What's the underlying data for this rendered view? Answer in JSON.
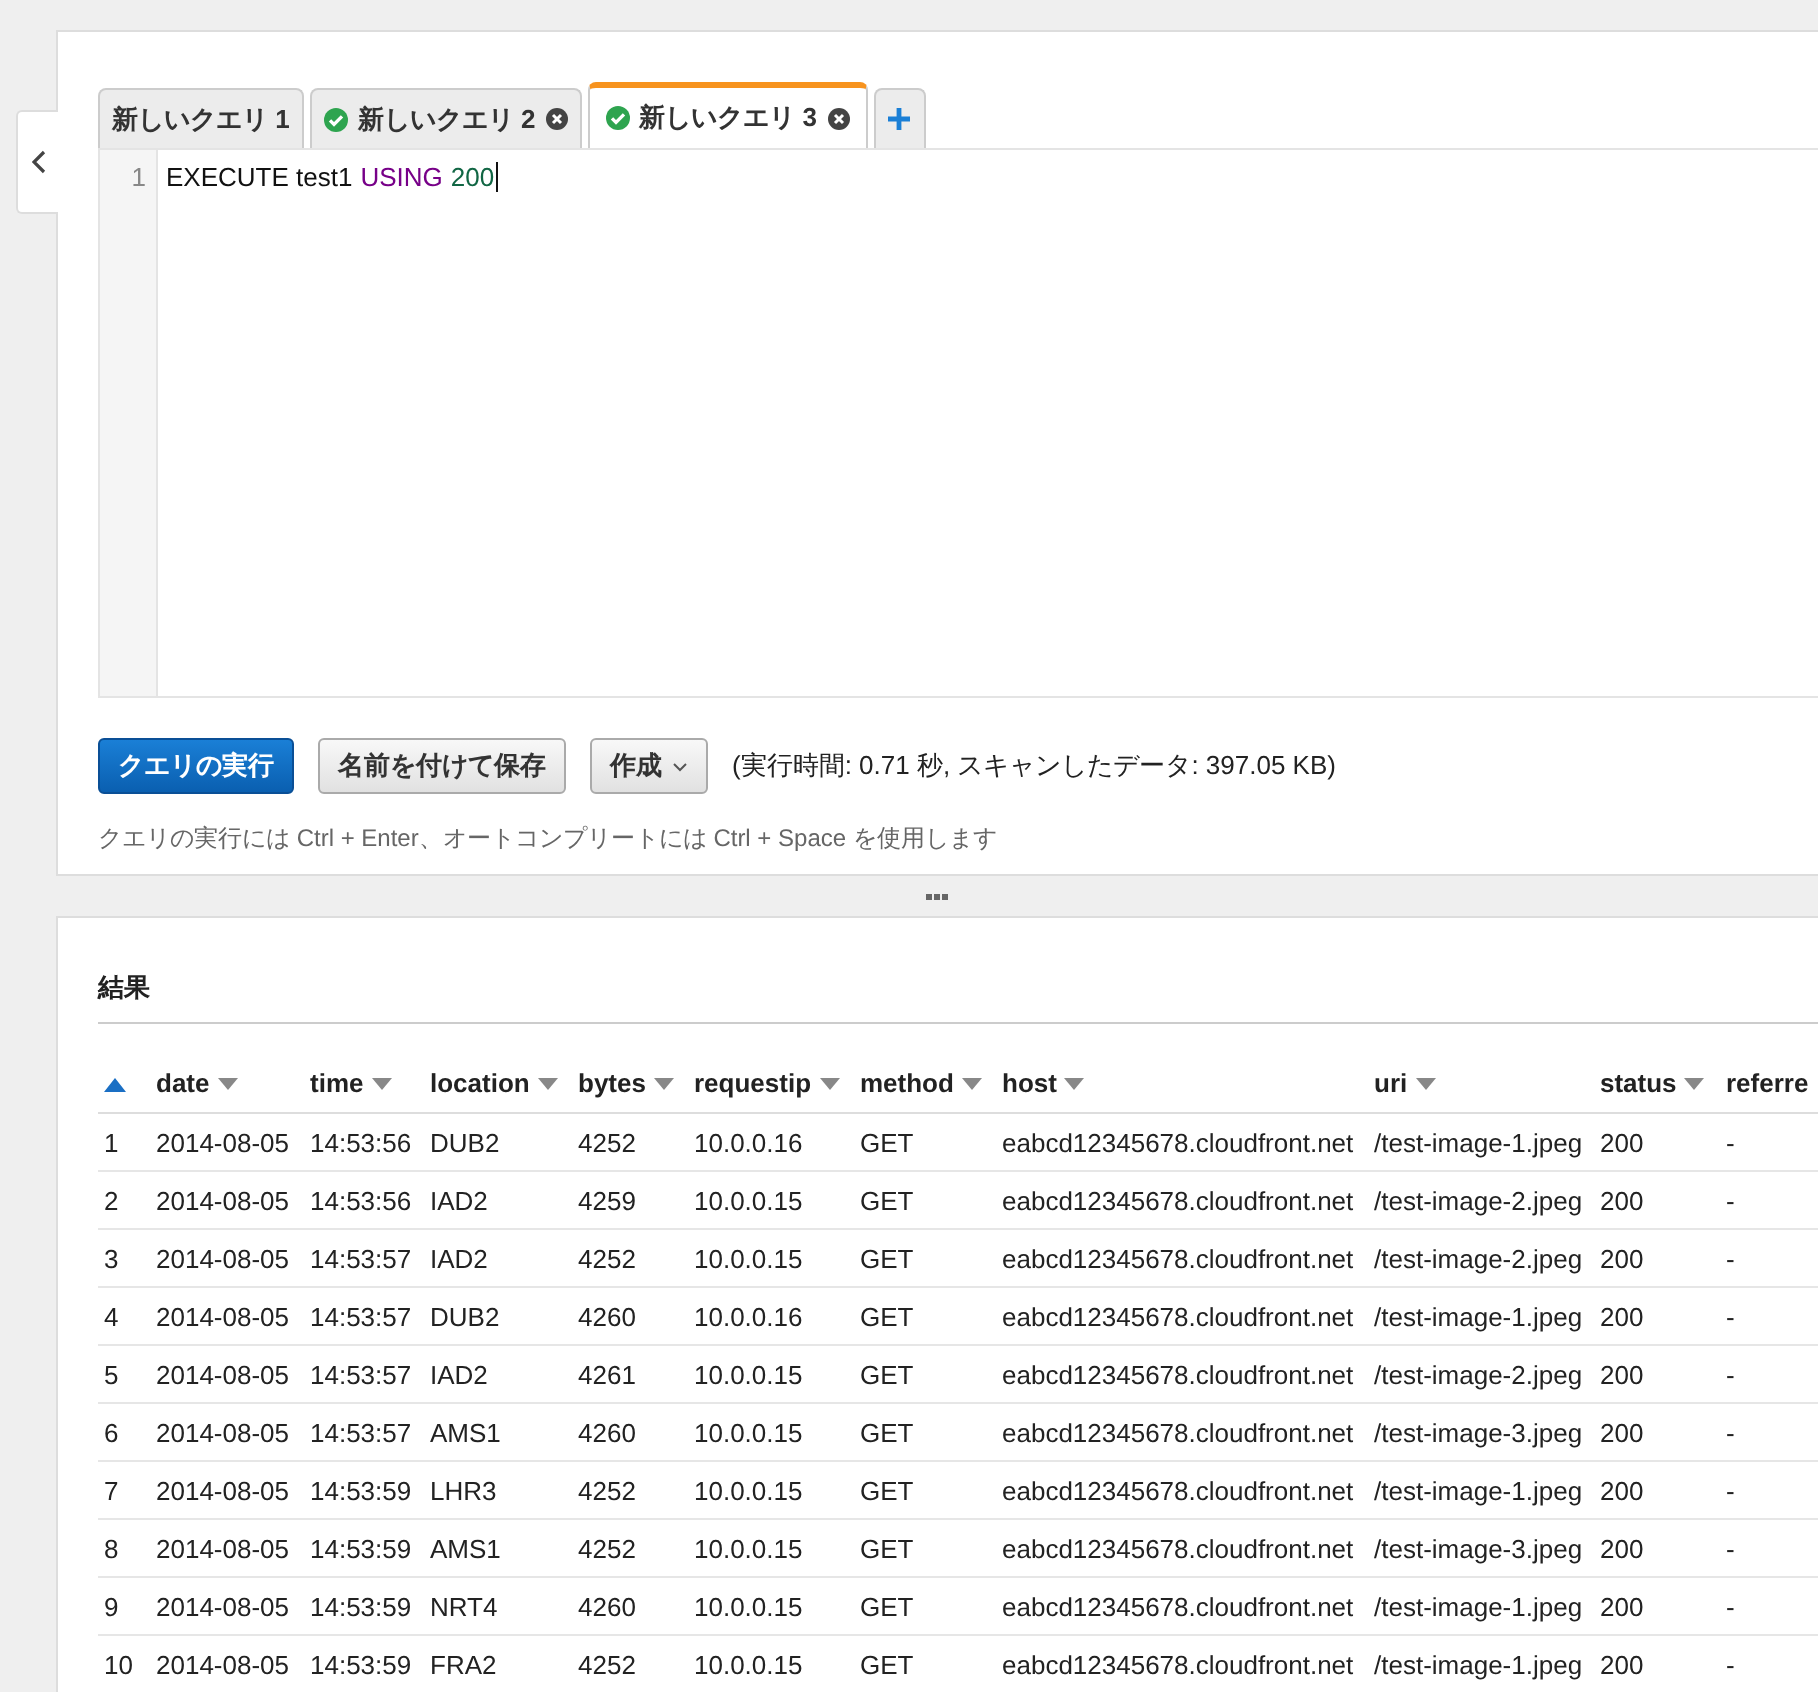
{
  "tabs": [
    {
      "label": "新しいクエリ 1",
      "selected": false,
      "succeeded": false,
      "closable": false
    },
    {
      "label": "新しいクエリ 2",
      "selected": false,
      "succeeded": true,
      "closable": true
    },
    {
      "label": "新しいクエリ 3",
      "selected": true,
      "succeeded": true,
      "closable": true
    }
  ],
  "editor": {
    "line_numbers": [
      "1"
    ],
    "tokens": [
      {
        "text": "EXECUTE test1",
        "kind": "plain"
      },
      {
        "text": "USING",
        "kind": "keyword"
      },
      {
        "text": "200",
        "kind": "number"
      }
    ]
  },
  "buttons": [
    {
      "label": "クエリの実行",
      "kind": "primary"
    },
    {
      "label": "名前を付けて保存",
      "kind": "secondary"
    },
    {
      "label": "作成",
      "kind": "dropdown"
    }
  ],
  "run_info": "(実行時間: 0.71 秒, スキャンしたデータ: 397.05 KB)",
  "hint": "クエリの実行には Ctrl + Enter、オートコンプリートには Ctrl + Space を使用します",
  "results": {
    "title": "結果",
    "columns": [
      "",
      "date",
      "time",
      "location",
      "bytes",
      "requestip",
      "method",
      "host",
      "uri",
      "status",
      "referre"
    ],
    "rows": [
      [
        "1",
        "2014-08-05",
        "14:53:56",
        "DUB2",
        "4252",
        "10.0.0.16",
        "GET",
        "eabcd12345678.cloudfront.net",
        "/test-image-1.jpeg",
        "200",
        "-"
      ],
      [
        "2",
        "2014-08-05",
        "14:53:56",
        "IAD2",
        "4259",
        "10.0.0.15",
        "GET",
        "eabcd12345678.cloudfront.net",
        "/test-image-2.jpeg",
        "200",
        "-"
      ],
      [
        "3",
        "2014-08-05",
        "14:53:57",
        "IAD2",
        "4252",
        "10.0.0.15",
        "GET",
        "eabcd12345678.cloudfront.net",
        "/test-image-2.jpeg",
        "200",
        "-"
      ],
      [
        "4",
        "2014-08-05",
        "14:53:57",
        "DUB2",
        "4260",
        "10.0.0.16",
        "GET",
        "eabcd12345678.cloudfront.net",
        "/test-image-1.jpeg",
        "200",
        "-"
      ],
      [
        "5",
        "2014-08-05",
        "14:53:57",
        "IAD2",
        "4261",
        "10.0.0.15",
        "GET",
        "eabcd12345678.cloudfront.net",
        "/test-image-2.jpeg",
        "200",
        "-"
      ],
      [
        "6",
        "2014-08-05",
        "14:53:57",
        "AMS1",
        "4260",
        "10.0.0.15",
        "GET",
        "eabcd12345678.cloudfront.net",
        "/test-image-3.jpeg",
        "200",
        "-"
      ],
      [
        "7",
        "2014-08-05",
        "14:53:59",
        "LHR3",
        "4252",
        "10.0.0.15",
        "GET",
        "eabcd12345678.cloudfront.net",
        "/test-image-1.jpeg",
        "200",
        "-"
      ],
      [
        "8",
        "2014-08-05",
        "14:53:59",
        "AMS1",
        "4252",
        "10.0.0.15",
        "GET",
        "eabcd12345678.cloudfront.net",
        "/test-image-3.jpeg",
        "200",
        "-"
      ],
      [
        "9",
        "2014-08-05",
        "14:53:59",
        "NRT4",
        "4260",
        "10.0.0.15",
        "GET",
        "eabcd12345678.cloudfront.net",
        "/test-image-1.jpeg",
        "200",
        "-"
      ],
      [
        "10",
        "2014-08-05",
        "14:53:59",
        "FRA2",
        "4252",
        "10.0.0.15",
        "GET",
        "eabcd12345678.cloudfront.net",
        "/test-image-1.jpeg",
        "200",
        "-"
      ]
    ]
  }
}
